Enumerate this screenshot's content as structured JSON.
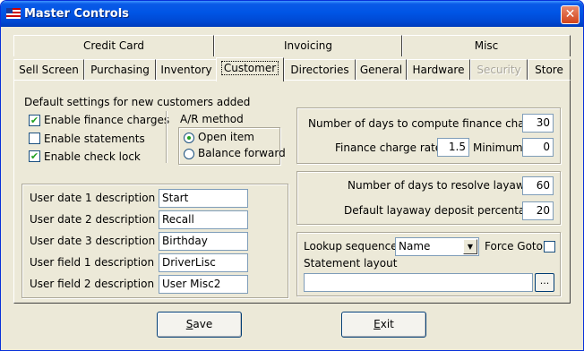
{
  "window": {
    "title": "Master Controls",
    "close": "✕"
  },
  "tabs_row1": [
    "Credit Card",
    "Invoicing",
    "Misc"
  ],
  "tabs_row2": [
    {
      "label": "Sell Screen"
    },
    {
      "label": "Purchasing"
    },
    {
      "label": "Inventory"
    },
    {
      "label": "Customer"
    },
    {
      "label": "Directories"
    },
    {
      "label": "General"
    },
    {
      "label": "Hardware"
    },
    {
      "label": "Security"
    },
    {
      "label": "Store"
    }
  ],
  "defaults": {
    "heading": "Default settings for new customers added",
    "enable_finance": {
      "label": "Enable finance charges",
      "checked": "✔"
    },
    "enable_statements": {
      "label": "Enable statements",
      "checked": ""
    },
    "enable_check_lock": {
      "label": "Enable check lock",
      "checked": "✔"
    }
  },
  "ar_method": {
    "label": "A/R method",
    "open_item": "Open item",
    "balance_forward": "Balance forward"
  },
  "user_fields": [
    {
      "label": "User date 1 description",
      "value": "Start"
    },
    {
      "label": "User date 2 description",
      "value": "Recall"
    },
    {
      "label": "User date 3 description",
      "value": "Birthday"
    },
    {
      "label": "User field 1 description",
      "value": "DriverLisc"
    },
    {
      "label": "User field 2 description",
      "value": "User Misc2"
    }
  ],
  "finance": {
    "days_label": "Number of days to compute finance charge",
    "days_value": "30",
    "rate_label": "Finance charge rate",
    "rate_value": "1.5",
    "minimum_label": "Minimum",
    "minimum_value": "0"
  },
  "layaway": {
    "days_label": "Number of days to resolve layaway",
    "days_value": "60",
    "deposit_label": "Default layaway deposit percentage",
    "deposit_value": "20"
  },
  "lookup": {
    "sequence_label": "Lookup sequence",
    "sequence_value": "Name",
    "force_goto_label": "Force Goto",
    "statement_layout_label": "Statement layout",
    "statement_layout_value": "",
    "browse_label": "..."
  },
  "buttons": {
    "save_prefix": "S",
    "save_rest": "ave",
    "exit_prefix": "E",
    "exit_rest": "xit"
  }
}
